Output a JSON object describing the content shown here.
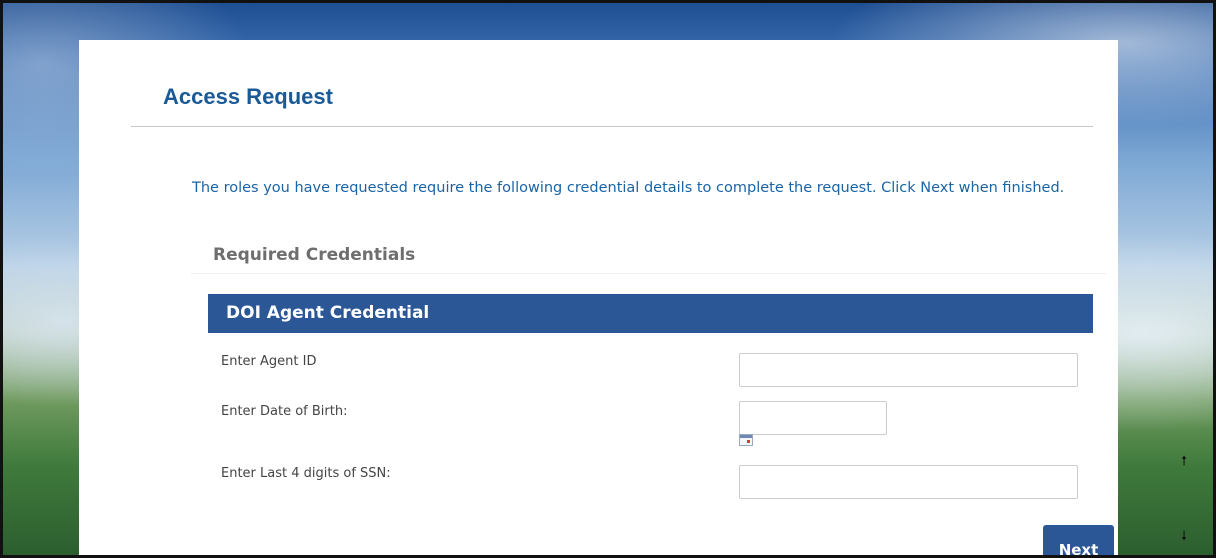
{
  "page": {
    "title": "Access Request",
    "intro": "The roles you have requested require the following credential details to complete the request. Click Next when finished.",
    "section_heading": "Required Credentials"
  },
  "credential": {
    "title": "DOI Agent Credential",
    "fields": [
      {
        "label": "Enter Agent ID",
        "value": "",
        "placeholder": ""
      },
      {
        "label": "Enter Date of Birth:",
        "value": "",
        "placeholder": ""
      },
      {
        "label": "Enter Last 4 digits of SSN:",
        "value": "",
        "placeholder": ""
      }
    ],
    "calendar_icon": "calendar-icon"
  },
  "actions": {
    "next_label": "Next"
  },
  "scroll": {
    "up_icon": "arrow-up-icon",
    "up_glyph": "🠕",
    "down_icon": "arrow-down-icon",
    "down_glyph": "🠗"
  },
  "colors": {
    "title": "#1a5a96",
    "intro_text": "#1b64a5",
    "accent_bar": "#2b5797",
    "button": "#2b5797"
  }
}
